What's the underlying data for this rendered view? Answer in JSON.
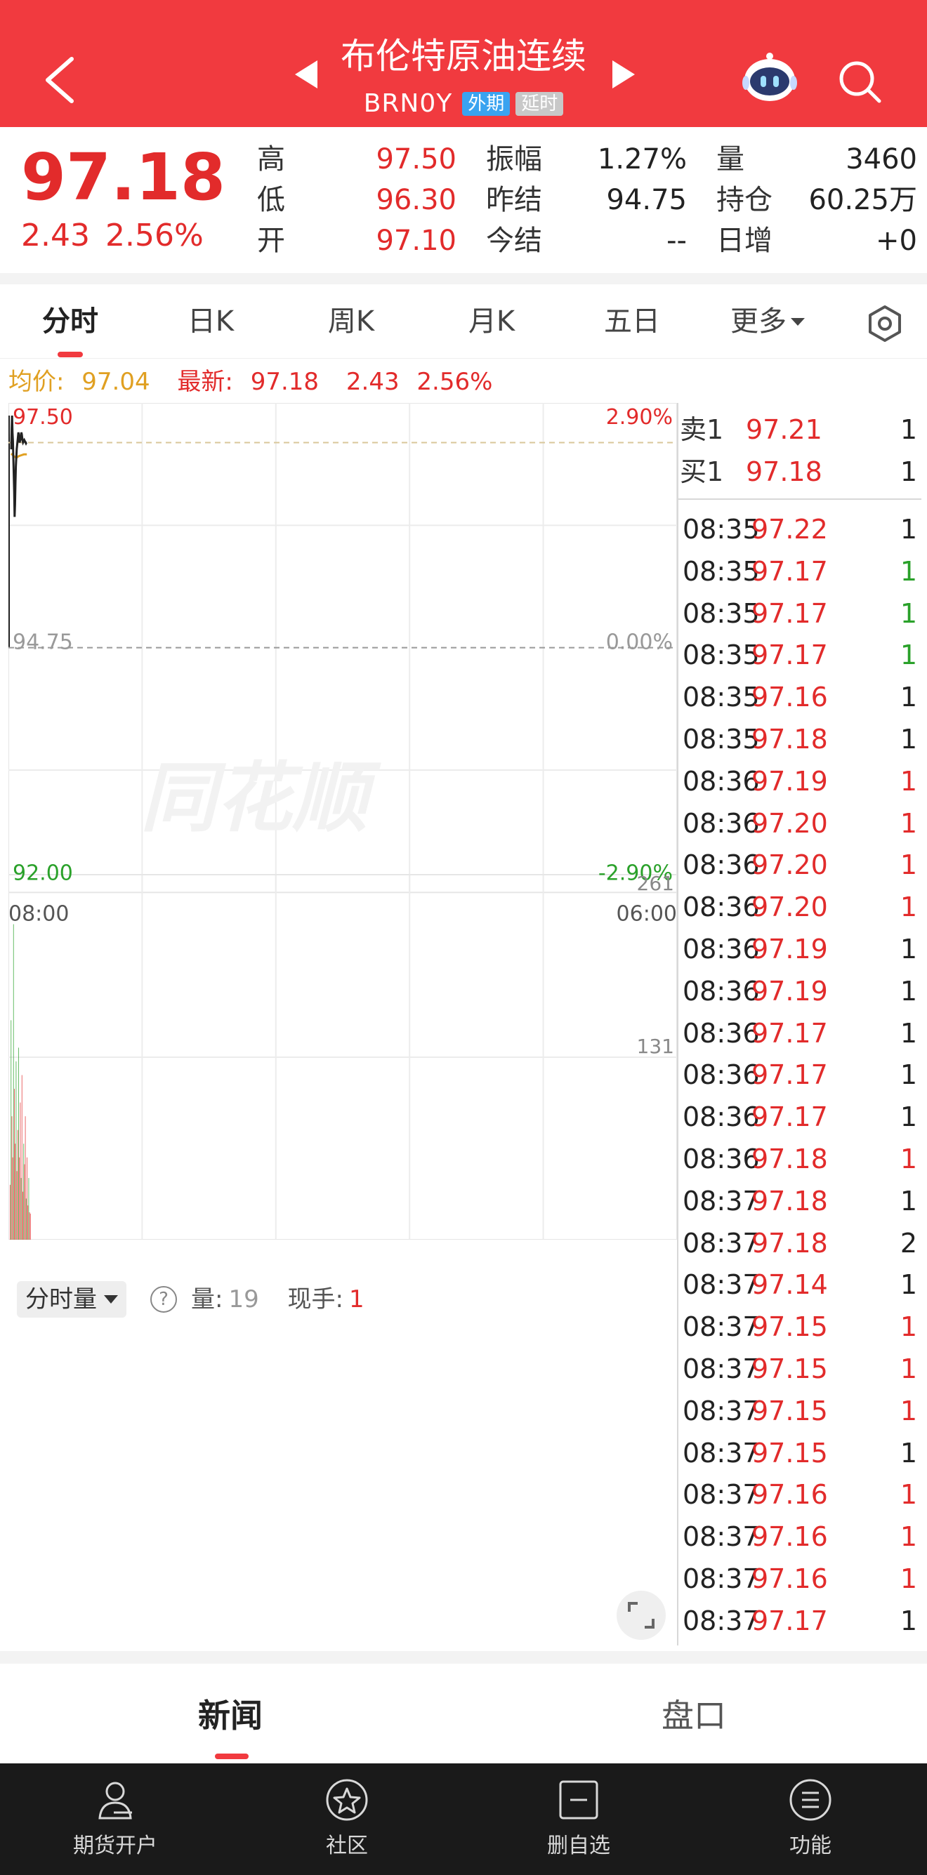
{
  "header": {
    "title": "布伦特原油连续",
    "code": "BRN0Y",
    "badges": [
      "外期",
      "延时"
    ]
  },
  "quote": {
    "price": "97.18",
    "change": "2.43",
    "change_pct": "2.56%",
    "col1": [
      {
        "label": "高",
        "value": "97.50"
      },
      {
        "label": "低",
        "value": "96.30"
      },
      {
        "label": "开",
        "value": "97.10"
      }
    ],
    "col2": [
      {
        "label": "振幅",
        "value": "1.27%"
      },
      {
        "label": "昨结",
        "value": "94.75"
      },
      {
        "label": "今结",
        "value": "--"
      }
    ],
    "col3": [
      {
        "label": "量",
        "value": "3460"
      },
      {
        "label": "持仓",
        "value": "60.25万"
      },
      {
        "label": "日增",
        "value": "+0"
      }
    ]
  },
  "tabs": [
    {
      "label": "分时"
    },
    {
      "label": "日K"
    },
    {
      "label": "周K"
    },
    {
      "label": "月K"
    },
    {
      "label": "五日"
    },
    {
      "label": "更多"
    }
  ],
  "info_line": {
    "avg_label": "均价:",
    "avg_value": "97.04",
    "latest_label": "最新:",
    "latest_value": "97.18",
    "change": "2.43",
    "change_pct": "2.56%"
  },
  "chart_data": {
    "type": "line",
    "title": "",
    "y_labels_left": [
      "97.50",
      "94.75",
      "92.00"
    ],
    "y_labels_right": [
      "2.90%",
      "0.00%",
      "-2.90%"
    ],
    "x_labels": [
      "08:00",
      "06:00"
    ],
    "ylim": [
      92.0,
      97.5
    ],
    "ref_price": 94.75,
    "watermark": "同花顺",
    "price_series": {
      "x": [
        0,
        1,
        2,
        3,
        4,
        5,
        6,
        7,
        8,
        9,
        10,
        11,
        12,
        13,
        14,
        15,
        16,
        17,
        18,
        19,
        20,
        21,
        22,
        23,
        24,
        25,
        26,
        27,
        28,
        29,
        30,
        31,
        32,
        33,
        34,
        35,
        36,
        37
      ],
      "values": [
        97.1,
        97.35,
        97.5,
        97.3,
        97.2,
        97.0,
        96.8,
        96.6,
        96.3,
        96.45,
        96.7,
        96.9,
        97.0,
        97.1,
        97.15,
        97.2,
        97.25,
        97.3,
        97.28,
        97.22,
        97.18,
        97.2,
        97.22,
        97.25,
        97.3,
        97.28,
        97.24,
        97.2,
        97.18,
        97.19,
        97.2,
        97.21,
        97.2,
        97.19,
        97.18,
        97.17,
        97.18,
        97.18
      ]
    },
    "avg_series": {
      "x": [
        0,
        6,
        12,
        18,
        24,
        30,
        37
      ],
      "values": [
        97.05,
        97.02,
        97.0,
        97.02,
        97.03,
        97.04,
        97.04
      ]
    },
    "volume": {
      "y_labels": [
        "261",
        "131"
      ],
      "ylim": [
        0,
        261
      ],
      "bars": [
        40,
        160,
        90,
        60,
        230,
        110,
        70,
        130,
        50,
        80,
        140,
        60,
        100,
        45,
        120,
        35,
        70,
        55,
        90,
        30,
        60,
        25,
        45,
        20,
        19
      ]
    }
  },
  "orderbook": [
    {
      "label": "卖1",
      "price": "97.21",
      "vol": "1"
    },
    {
      "label": "买1",
      "price": "97.18",
      "vol": "1"
    }
  ],
  "trades": [
    {
      "time": "08:35",
      "price": "97.22",
      "vol": "1",
      "dir": "n"
    },
    {
      "time": "08:35",
      "price": "97.17",
      "vol": "1",
      "dir": "g"
    },
    {
      "time": "08:35",
      "price": "97.17",
      "vol": "1",
      "dir": "g"
    },
    {
      "time": "08:35",
      "price": "97.17",
      "vol": "1",
      "dir": "g"
    },
    {
      "time": "08:35",
      "price": "97.16",
      "vol": "1",
      "dir": "n"
    },
    {
      "time": "08:35",
      "price": "97.18",
      "vol": "1",
      "dir": "n"
    },
    {
      "time": "08:36",
      "price": "97.19",
      "vol": "1",
      "dir": "r"
    },
    {
      "time": "08:36",
      "price": "97.20",
      "vol": "1",
      "dir": "r"
    },
    {
      "time": "08:36",
      "price": "97.20",
      "vol": "1",
      "dir": "r"
    },
    {
      "time": "08:36",
      "price": "97.20",
      "vol": "1",
      "dir": "r"
    },
    {
      "time": "08:36",
      "price": "97.19",
      "vol": "1",
      "dir": "n"
    },
    {
      "time": "08:36",
      "price": "97.19",
      "vol": "1",
      "dir": "n"
    },
    {
      "time": "08:36",
      "price": "97.17",
      "vol": "1",
      "dir": "n"
    },
    {
      "time": "08:36",
      "price": "97.17",
      "vol": "1",
      "dir": "n"
    },
    {
      "time": "08:36",
      "price": "97.17",
      "vol": "1",
      "dir": "n"
    },
    {
      "time": "08:36",
      "price": "97.18",
      "vol": "1",
      "dir": "r"
    },
    {
      "time": "08:37",
      "price": "97.18",
      "vol": "1",
      "dir": "n"
    },
    {
      "time": "08:37",
      "price": "97.18",
      "vol": "2",
      "dir": "n"
    },
    {
      "time": "08:37",
      "price": "97.14",
      "vol": "1",
      "dir": "n"
    },
    {
      "time": "08:37",
      "price": "97.15",
      "vol": "1",
      "dir": "r"
    },
    {
      "time": "08:37",
      "price": "97.15",
      "vol": "1",
      "dir": "r"
    },
    {
      "time": "08:37",
      "price": "97.15",
      "vol": "1",
      "dir": "r"
    },
    {
      "time": "08:37",
      "price": "97.15",
      "vol": "1",
      "dir": "n"
    },
    {
      "time": "08:37",
      "price": "97.16",
      "vol": "1",
      "dir": "r"
    },
    {
      "time": "08:37",
      "price": "97.16",
      "vol": "1",
      "dir": "r"
    },
    {
      "time": "08:37",
      "price": "97.16",
      "vol": "1",
      "dir": "r"
    },
    {
      "time": "08:37",
      "price": "97.17",
      "vol": "1",
      "dir": "n"
    }
  ],
  "volume_ctrl": {
    "selector": "分时量",
    "help": "?",
    "vol_label": "量:",
    "vol_value": "19",
    "cur_label": "现手:",
    "cur_value": "1"
  },
  "bottom_tabs": [
    {
      "label": "新闻"
    },
    {
      "label": "盘口"
    }
  ],
  "nav": [
    {
      "label": "期货开户",
      "icon": "user-icon"
    },
    {
      "label": "社区",
      "icon": "star-icon"
    },
    {
      "label": "删自选",
      "icon": "minus-icon"
    },
    {
      "label": "功能",
      "icon": "menu-icon"
    }
  ],
  "colors": {
    "brand_red": "#f13a3f",
    "up_red": "#e22b2b",
    "down_green": "#2aa12a",
    "avg_orange": "#e0a022"
  }
}
